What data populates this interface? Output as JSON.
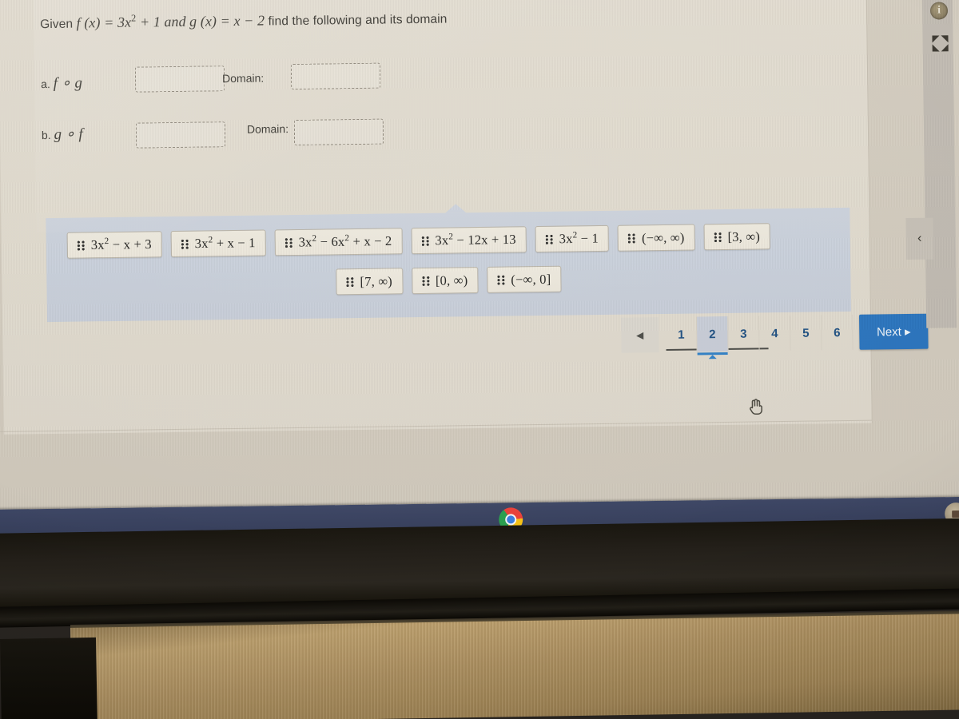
{
  "question": {
    "prompt_prefix": "Given",
    "f_def": "f (x) = 3x² + 1",
    "conjunction": "and",
    "g_def": "g (x) = x − 2",
    "prompt_suffix": "find the following and its domain"
  },
  "answers": {
    "rows": [
      {
        "label": "a. f ∘ g",
        "letter": "a.",
        "expression": "f ∘ g",
        "answer_value": "",
        "answer_placeholder": "",
        "domain_label": "Domain:",
        "domain_value": "",
        "domain_placeholder": ""
      },
      {
        "label": "b. g ∘ f",
        "letter": "b.",
        "expression": "g ∘ f",
        "answer_value": "",
        "answer_placeholder": "",
        "domain_label": "Domain:",
        "domain_value": "",
        "domain_placeholder": ""
      }
    ]
  },
  "answer_bank": {
    "row1": [
      "3x² − x + 3",
      "3x² + x − 1",
      "3x² − 6x² + x − 2",
      "3x² − 12x + 13",
      "3x² − 1",
      "(−∞, ∞)",
      "[3, ∞)"
    ],
    "row2": [
      "[7, ∞)",
      "[0, ∞)",
      "(−∞, 0]"
    ],
    "grip_icon": "drag-grip-icon"
  },
  "pagination": {
    "prev_label": "◀",
    "pages": [
      "1",
      "2",
      "3",
      "4",
      "5",
      "6"
    ],
    "current_page": "2",
    "next_label": "Next ▸"
  },
  "toolbar": {
    "info_icon": "info-icon",
    "info_glyph": "i",
    "expand_icon": "fullscreen-expand-icon",
    "collapse_icon": "chevron-left-icon",
    "collapse_glyph": "‹"
  },
  "shelf": {
    "chrome_icon": "chrome-browser-icon",
    "status_icon": "status-tray-icon"
  },
  "cursor": {
    "icon": "hand-pointer-cursor"
  },
  "colors": {
    "accent_blue": "#2a74bd",
    "page_link_blue": "#1d4e80",
    "bank_panel": "#ccd2dc",
    "tile_face": "#ebe6da",
    "paper": "#e0dacd",
    "shelf": "#343c58"
  }
}
